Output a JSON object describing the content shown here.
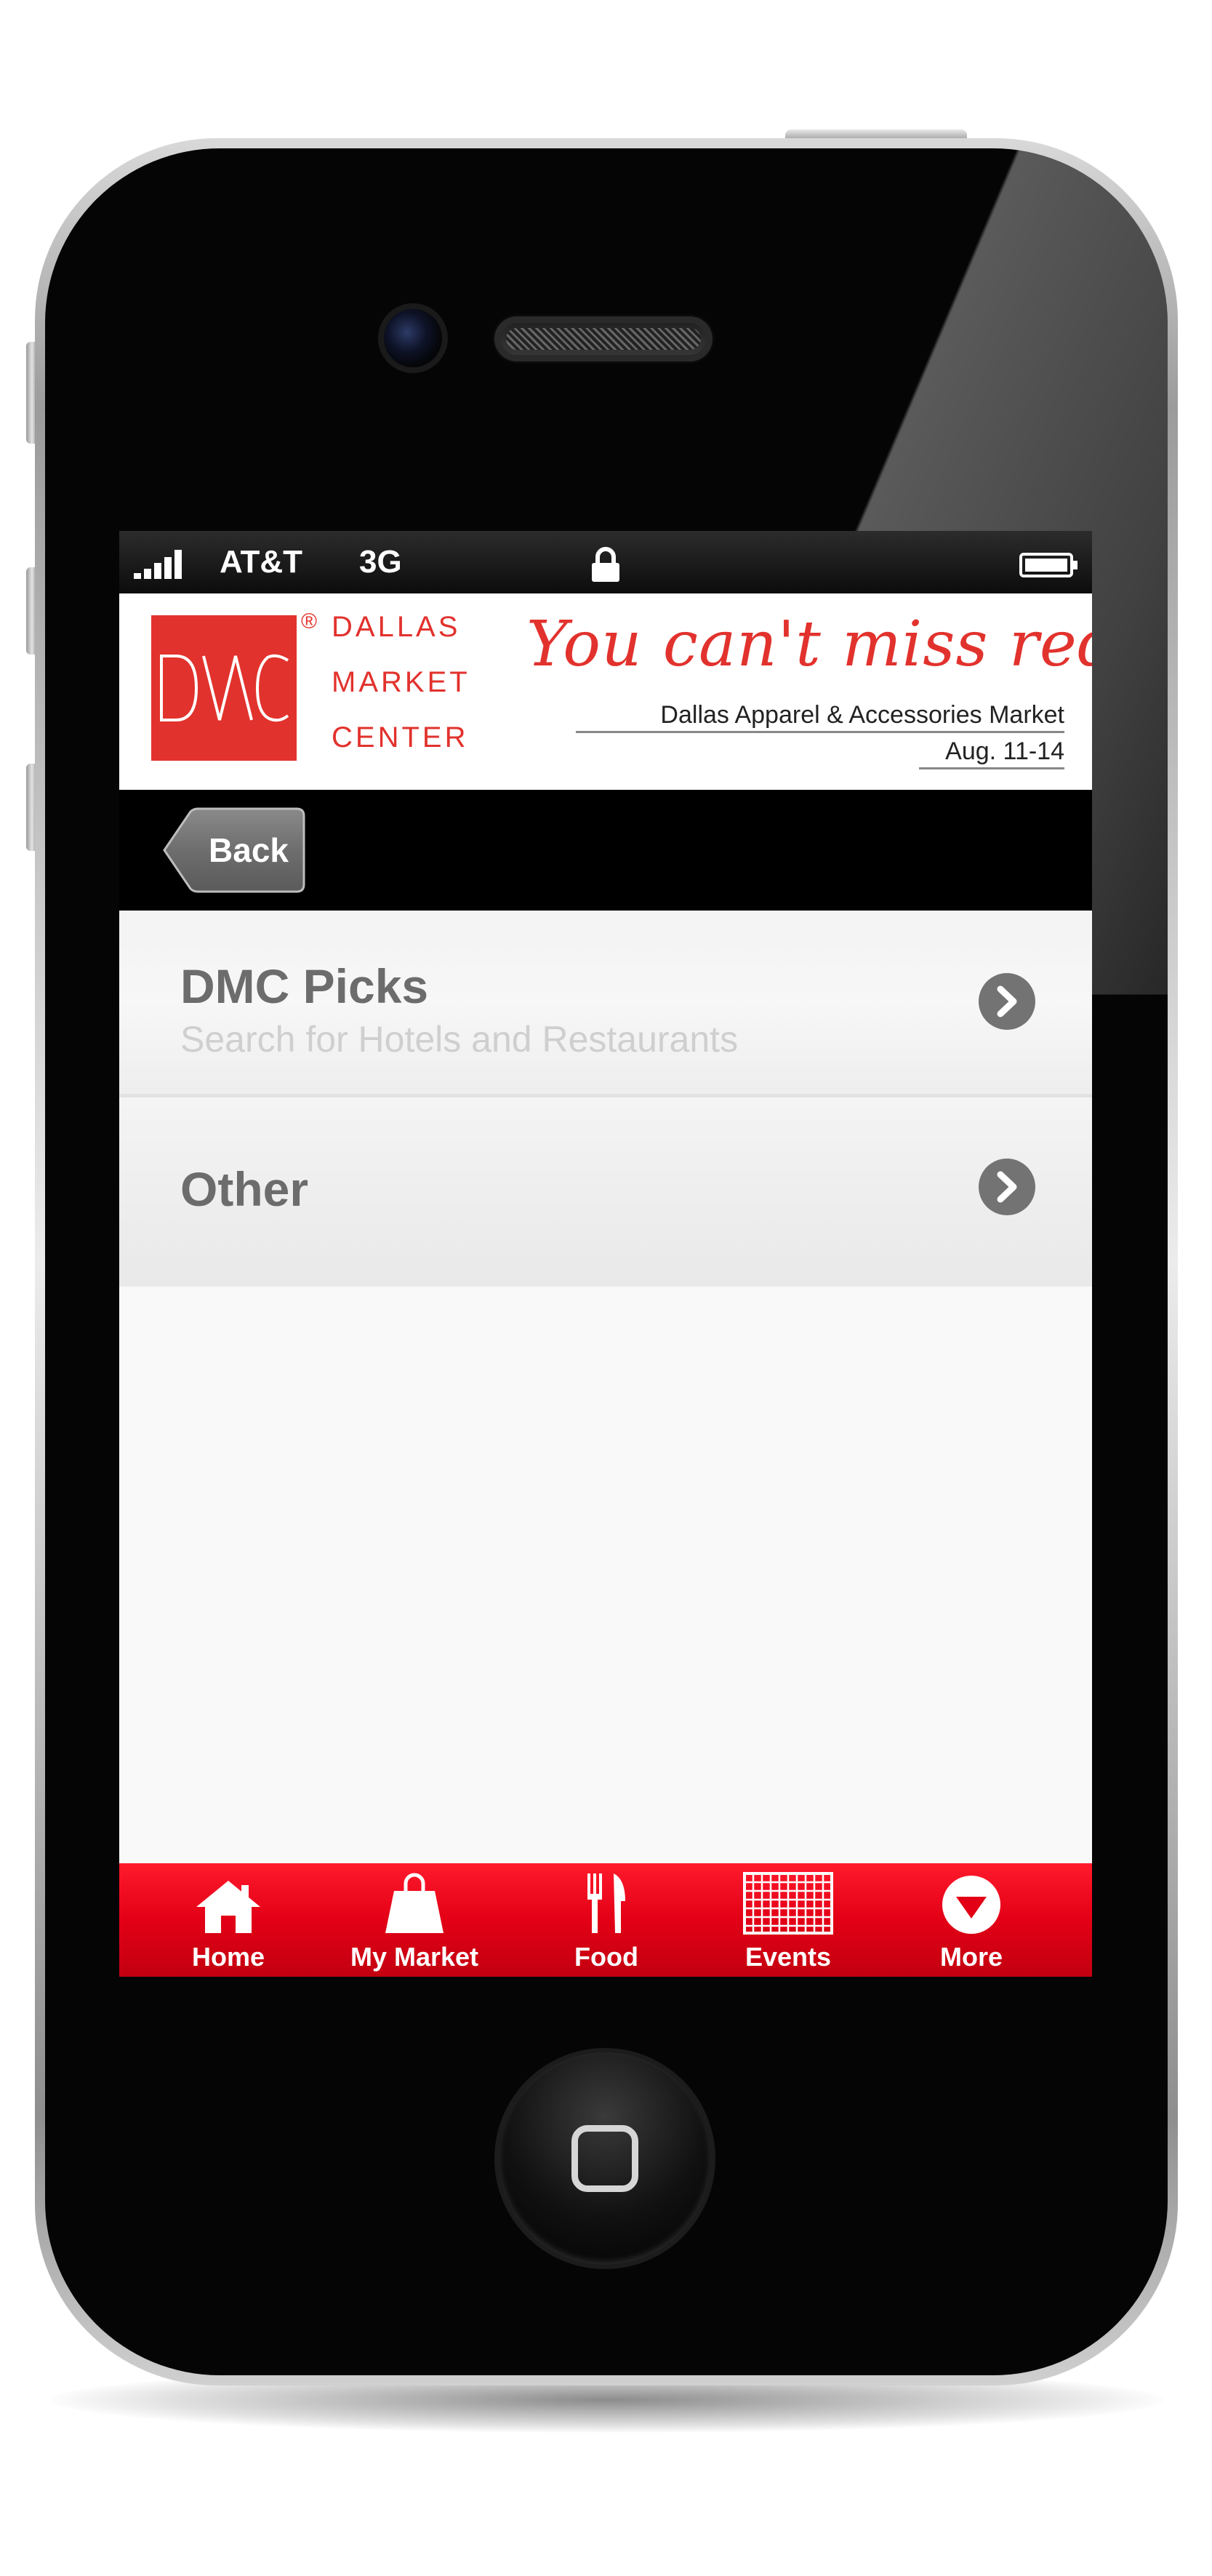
{
  "status_bar": {
    "carrier": "AT&T",
    "network": "3G",
    "icons": [
      "signal-icon",
      "lock-icon",
      "battery-icon"
    ]
  },
  "header": {
    "logo_text": "DMC",
    "brand_lines": [
      "DALLAS",
      "MARKET",
      "CENTER"
    ],
    "registered_mark": "®",
    "tagline": "You can't miss red.",
    "market_name": "Dallas Apparel & Accessories Market",
    "market_dates": "Aug. 11-14"
  },
  "nav": {
    "back_label": "Back"
  },
  "list": [
    {
      "title": "DMC Picks",
      "subtitle": "Search for Hotels and Restaurants",
      "icon": "chevron-right-icon"
    },
    {
      "title": "Other",
      "subtitle": "",
      "icon": "chevron-right-icon"
    }
  ],
  "tabs": [
    {
      "label": "Home",
      "icon": "home-icon"
    },
    {
      "label": "My Market",
      "icon": "shopping-bag-icon"
    },
    {
      "label": "Food",
      "icon": "fork-knife-icon"
    },
    {
      "label": "Events",
      "icon": "calendar-grid-icon"
    },
    {
      "label": "More",
      "icon": "more-icon"
    }
  ],
  "colors": {
    "brand_red": "#e2322d",
    "tab_bar_red": "#e30016",
    "nav_black": "#000000",
    "row_title_gray": "#6c6c6c",
    "row_subtitle_gray": "#cfcfcf"
  }
}
